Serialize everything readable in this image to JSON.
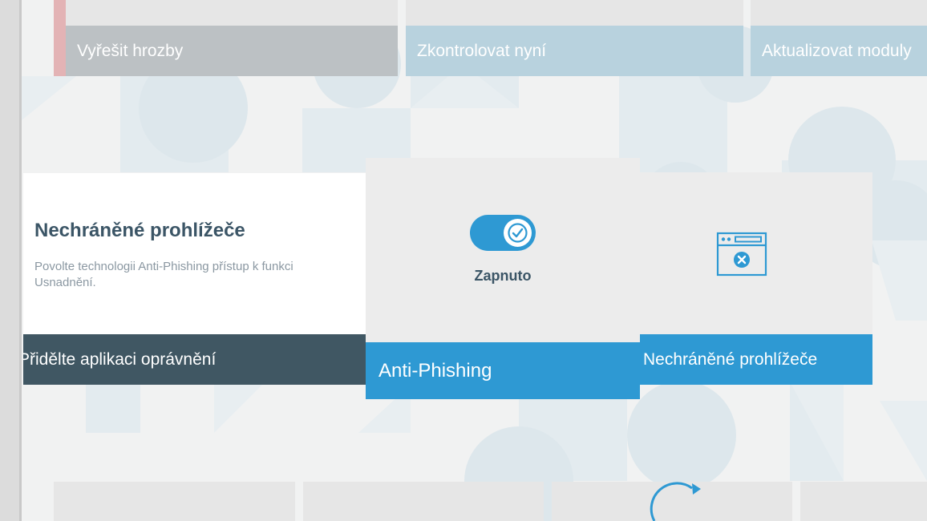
{
  "top_actions": [
    {
      "label": "Vyřešit hrozby"
    },
    {
      "label": "Zkontrolovat nyní"
    },
    {
      "label": "Aktualizovat moduly"
    }
  ],
  "info_card": {
    "title": "Nechráněné prohlížeče",
    "description": "Povolte technologii Anti-Phishing přístup k funkci Usnadnění.",
    "action_label": "Přidělte aplikaci oprávnění"
  },
  "feature_card": {
    "toggle_state": "Zapnuto",
    "toggle_on": true,
    "button_label": "Anti-Phishing"
  },
  "browser_card": {
    "icon": "browser-blocked-icon",
    "button_label": "Nechráněné prohlížeče"
  },
  "colors": {
    "accent_blue": "#2e99d3",
    "dark_slate": "#405763",
    "warning_red": "#e3b3b5"
  }
}
